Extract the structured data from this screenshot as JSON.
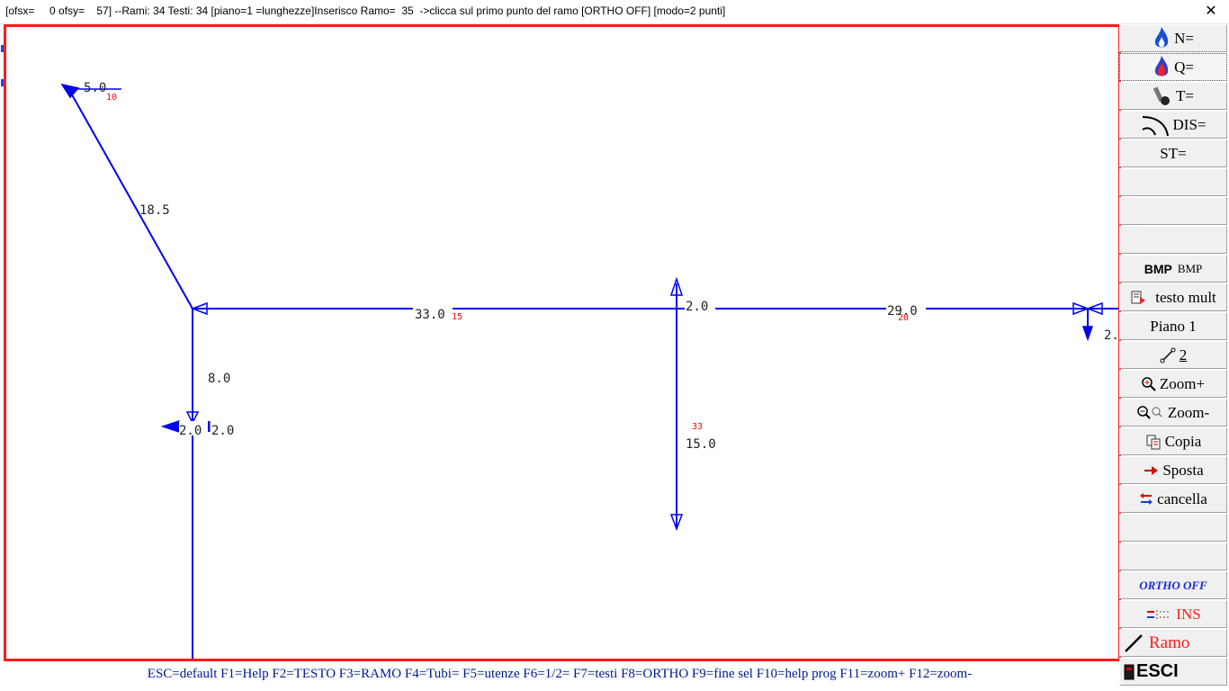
{
  "window": {
    "title": "[ofsx=     0 ofsy=    57] --Rami: 34 Testi: 34 [piano=1 =lunghezze]Inserisco Ramo=  35  ->clicca sul primo punto del ramo [ORTHO OFF] [modo=2 punti]",
    "close_glyph": "✕"
  },
  "drawing": {
    "line_color": "#0000ee",
    "frame_color": "#ff1a1a",
    "dimensions": [
      "5.0",
      "18.5",
      "33.0",
      "2.0",
      "29.0",
      "2.",
      "8.0",
      "2.0",
      "2.0",
      "15.0"
    ],
    "branch_numbers": [
      "10",
      "15",
      "33",
      "20"
    ]
  },
  "sidebar": {
    "buttons": [
      {
        "label": "N=",
        "icon": "gas-flame-icon"
      },
      {
        "label": "Q=",
        "icon": "flame-icon"
      },
      {
        "label": "T=",
        "icon": "burner-icon"
      },
      {
        "label": "DIS=",
        "icon": "curve-icon"
      },
      {
        "label": "ST="
      },
      {
        "label": ""
      },
      {
        "label": ""
      },
      {
        "label": ""
      },
      {
        "label": "BMP",
        "label2": "BMP"
      },
      {
        "label": "testo mult",
        "icon": "text-icon"
      },
      {
        "label": "Piano 1"
      },
      {
        "label": "2",
        "icon": "segment-icon"
      },
      {
        "label": "Zoom+",
        "icon": "zoom-in-icon"
      },
      {
        "label": "Zoom-",
        "icon": "zoom-out-icon"
      },
      {
        "label": "Copia",
        "icon": "copy-icon"
      },
      {
        "label": "Sposta",
        "icon": "move-icon"
      },
      {
        "label": "cancella",
        "icon": "delete-icon"
      },
      {
        "label": ""
      },
      {
        "label": ""
      },
      {
        "label": "ORTHO OFF"
      },
      {
        "label": "INS",
        "icon": "insert-icon"
      },
      {
        "label": "Ramo",
        "icon": "line-icon"
      },
      {
        "label": "ESCI",
        "icon": "exit-icon"
      }
    ]
  },
  "statusbar": {
    "text": "ESC=default F1=Help F2=TESTO F3=RAMO F4=Tubi= F5=utenze F6=1/2= F7=testi F8=ORTHO F9=fine sel F10=help prog F11=zoom+ F12=zoom-"
  }
}
